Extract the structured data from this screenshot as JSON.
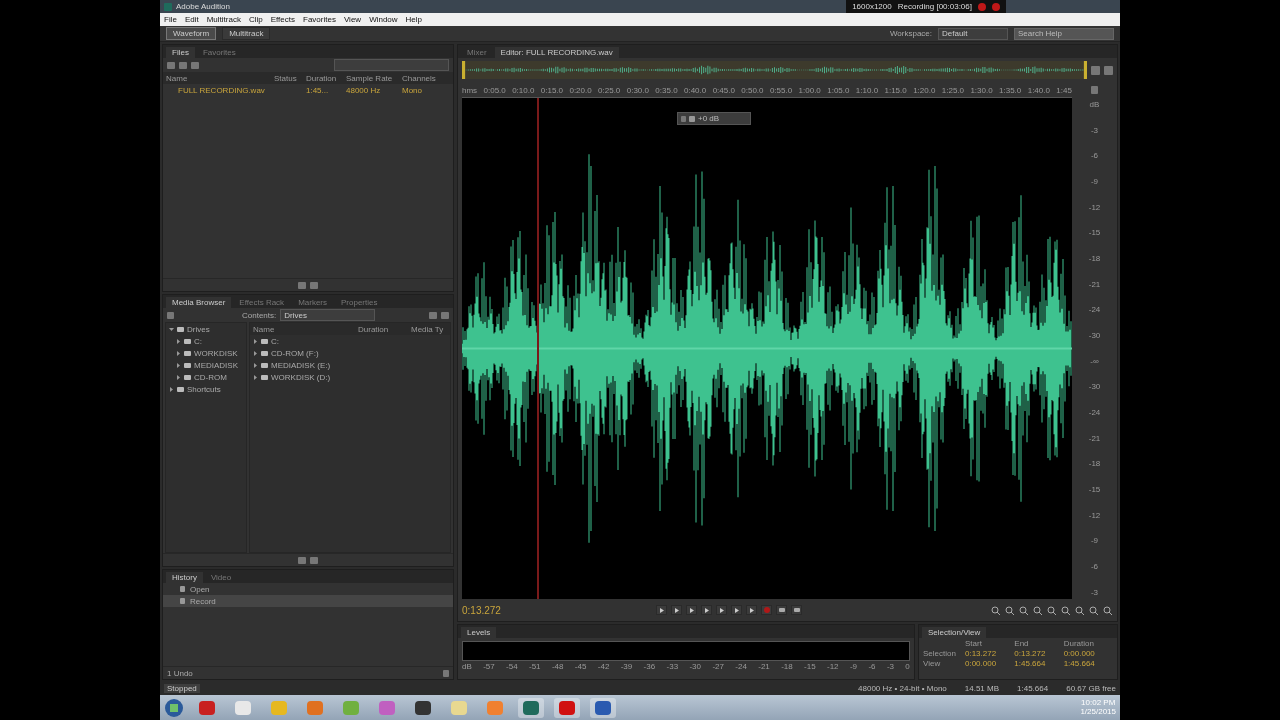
{
  "window": {
    "title": "Adobe Audition"
  },
  "recorder_overlay": {
    "resolution": "1600x1200",
    "status": "Recording [00:03:06]"
  },
  "menu": [
    "File",
    "Edit",
    "Multitrack",
    "Clip",
    "Effects",
    "Favorites",
    "View",
    "Window",
    "Help"
  ],
  "toolbar": {
    "modes": [
      {
        "label": "Waveform",
        "selected": true
      },
      {
        "label": "Multitrack",
        "selected": false
      }
    ],
    "workspace_label": "Workspace:",
    "workspace": "Default",
    "search": {
      "placeholder": "Search Help"
    }
  },
  "files_panel": {
    "tabs": [
      {
        "label": "Files",
        "selected": true
      },
      {
        "label": "Favorites",
        "selected": false
      }
    ],
    "columns": [
      "Name",
      "Status",
      "Duration",
      "Sample Rate",
      "Channels"
    ],
    "rows": [
      {
        "name": "FULL RECORDING.wav",
        "status": "",
        "duration": "1:45...",
        "sample_rate": "48000 Hz",
        "channels": "Mono"
      }
    ]
  },
  "media_browser": {
    "tabs": [
      {
        "label": "Media Browser",
        "selected": true
      },
      {
        "label": "Effects Rack",
        "selected": false
      },
      {
        "label": "Markers",
        "selected": false
      },
      {
        "label": "Properties",
        "selected": false
      }
    ],
    "contents_label": "Contents:",
    "contents": "Drives",
    "tree": [
      {
        "label": "Drives",
        "expanded": true,
        "children": [
          {
            "label": "C:"
          },
          {
            "label": "WORKDISK"
          },
          {
            "label": "MEDIADISK"
          },
          {
            "label": "CD-ROM"
          }
        ]
      },
      {
        "label": "Shortcuts",
        "expanded": false
      }
    ],
    "columns": [
      "Name",
      "Duration",
      "Media Ty"
    ],
    "items": [
      "C:",
      "CD-ROM (F:)",
      "MEDIADISK (E:)",
      "WORKDISK (D:)"
    ]
  },
  "history": {
    "tabs": [
      {
        "label": "History",
        "selected": true
      },
      {
        "label": "Video",
        "selected": false
      }
    ],
    "items": [
      {
        "label": "Open",
        "selected": false
      },
      {
        "label": "Record",
        "selected": true
      }
    ],
    "undo_count": "1 Undo"
  },
  "editor": {
    "tabs": [
      {
        "label": "Mixer",
        "selected": false
      },
      {
        "label": "Editor: FULL RECORDING.wav",
        "selected": true
      }
    ],
    "hud": "+0 dB",
    "ruler": [
      "hms",
      "0:05.0",
      "0:10.0",
      "0:15.0",
      "0:20.0",
      "0:25.0",
      "0:30.0",
      "0:35.0",
      "0:40.0",
      "0:45.0",
      "0:50.0",
      "0:55.0",
      "1:00.0",
      "1:05.0",
      "1:10.0",
      "1:15.0",
      "1:20.0",
      "1:25.0",
      "1:30.0",
      "1:35.0",
      "1:40.0",
      "1:45"
    ],
    "db_scale": [
      "dB",
      "-3",
      "-6",
      "-9",
      "-12",
      "-15",
      "-18",
      "-21",
      "-24",
      "-30",
      "-∞",
      "-30",
      "-24",
      "-21",
      "-18",
      "-15",
      "-12",
      "-9",
      "-6",
      "-3"
    ],
    "time": "0:13.272"
  },
  "levels": {
    "title": "Levels",
    "scale": [
      "dB",
      "-57",
      "-54",
      "-51",
      "-48",
      "-45",
      "-42",
      "-39",
      "-36",
      "-33",
      "-30",
      "-27",
      "-24",
      "-21",
      "-18",
      "-15",
      "-12",
      "-9",
      "-6",
      "-3",
      "0"
    ]
  },
  "selection_view": {
    "title": "Selection/View",
    "columns": [
      "Start",
      "End",
      "Duration"
    ],
    "rows": [
      {
        "label": "Selection",
        "start": "0:13.272",
        "end": "0:13.272",
        "duration": "0:00.000"
      },
      {
        "label": "View",
        "start": "0:00.000",
        "end": "1:45.664",
        "duration": "1:45.664"
      }
    ]
  },
  "status_bar": {
    "state": "Stopped",
    "format": "48000 Hz • 24-bit • Mono",
    "size": "14.51 MB",
    "duration": "1:45.664",
    "free": "60.67 GB free"
  },
  "taskbar": {
    "time": "10:02 PM",
    "date": "1/25/2015"
  }
}
